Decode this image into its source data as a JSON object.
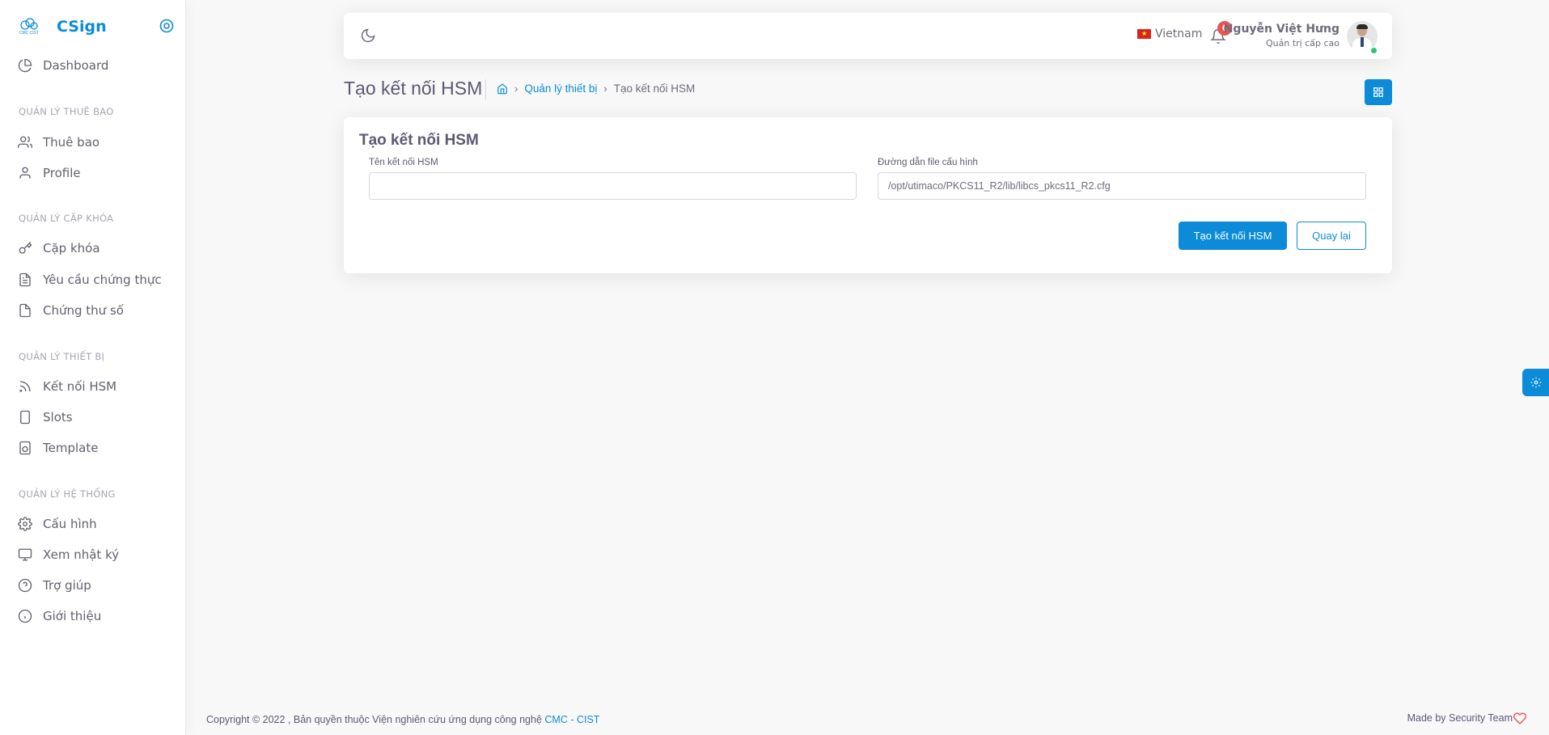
{
  "brand": {
    "name": "CSign",
    "logo_text": "CMC CIST"
  },
  "sidebar": {
    "dashboard": "Dashboard",
    "sections": [
      {
        "header": "QUẢN LÝ THUÊ BAO",
        "items": [
          "Thuê bao",
          "Profile"
        ]
      },
      {
        "header": "QUẢN LÝ CẶP KHÓA",
        "items": [
          "Cặp khóa",
          "Yêu cầu chứng thực",
          "Chứng thư số"
        ]
      },
      {
        "header": "QUẢN LÝ THIẾT BỊ",
        "items": [
          "Kết nối HSM",
          "Slots",
          "Template"
        ]
      },
      {
        "header": "QUẢN LÝ HỆ THỐNG",
        "items": [
          "Cấu hình",
          "Xem nhật ký",
          "Trợ giúp",
          "Giới thiệu"
        ]
      }
    ]
  },
  "navbar": {
    "language": "Vietnam",
    "notification_count": "6",
    "user_name": "Nguyễn Việt Hưng",
    "user_role": "Quản trị cấp cao"
  },
  "page": {
    "title": "Tạo kết nối HSM",
    "breadcrumb": {
      "parent": "Quản lý thiết bị",
      "current": "Tạo kết nối HSM"
    }
  },
  "form": {
    "card_title": "Tạo kết nối HSM",
    "name_label": "Tên kết nối HSM",
    "name_value": "",
    "path_label": "Đường dẫn file cấu hình",
    "path_value": "/opt/utimaco/PKCS11_R2/lib/libcs_pkcs11_R2.cfg",
    "submit_label": "Tạo kết nối HSM",
    "back_label": "Quay lại"
  },
  "footer": {
    "copyright": "Copyright © 2022 , Bản quyền thuộc Viện nghiên cứu ứng dụng công nghệ",
    "org_link": "CMC - CIST",
    "made_by": "Made by Security Team"
  },
  "colors": {
    "primary": "#0b8bd8",
    "badge": "#ea5455",
    "online": "#28c76f"
  },
  "icons": {
    "dashboard": "pie-chart-icon",
    "subscriber": "users-icon",
    "profile": "user-icon",
    "keypair": "key-icon",
    "csr": "file-text-icon",
    "certificate": "file-icon",
    "hsm": "rss-icon",
    "slots": "tablet-icon",
    "template": "speaker-icon",
    "config": "settings-icon",
    "logs": "monitor-icon",
    "help": "help-circle-icon",
    "about": "info-icon"
  }
}
